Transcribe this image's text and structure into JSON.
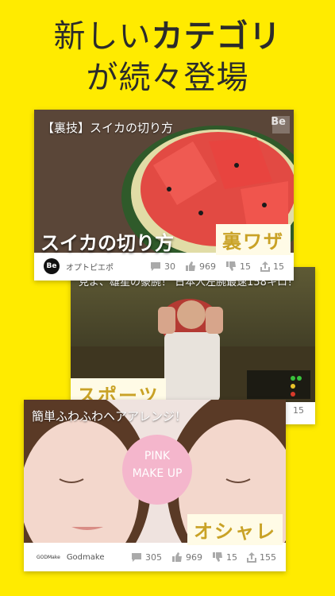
{
  "headline": {
    "line1_prefix": "新しい",
    "line1_emphasis": "カテゴリ",
    "line2": "が続々登場"
  },
  "cards": [
    {
      "caption": "【裏技】スイカの切り方",
      "title_overlay": "スイカの切り方",
      "brand_badge": "Be",
      "category": "裏ワザ",
      "channel_logo": "Be",
      "channel": "オプトピエポ",
      "comments": "30",
      "likes": "969",
      "dislikes": "15",
      "shares": "15"
    },
    {
      "caption": "見よ、雄星の豪腕！ 日本人左腕最速158キロ！",
      "category": "スポーツ",
      "shares": "15"
    },
    {
      "caption": "簡単ふわふわヘアアレンジ！",
      "badge_line1": "PINK",
      "badge_line2": "MAKE UP",
      "category": "オシャレ",
      "channel_logo": "GODMake",
      "channel": "Godmake",
      "comments": "305",
      "likes": "969",
      "dislikes": "15",
      "shares": "155"
    }
  ]
}
